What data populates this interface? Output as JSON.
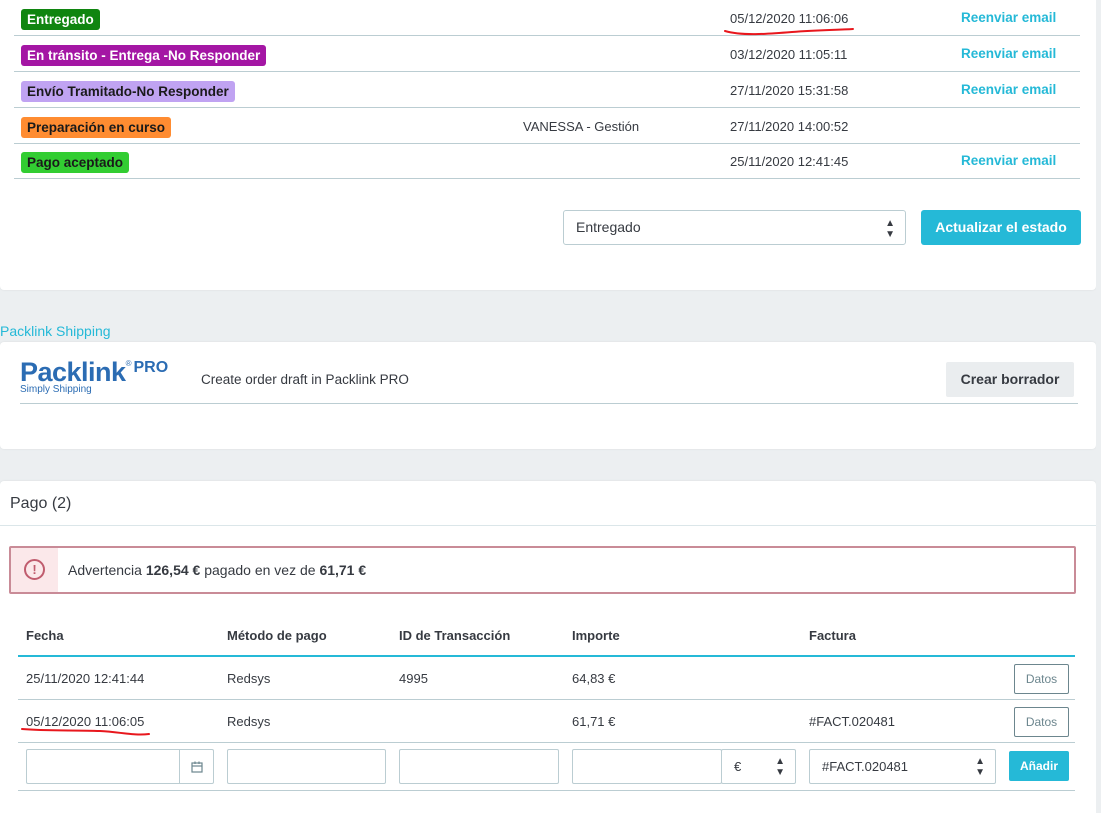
{
  "status_history": {
    "rows": [
      {
        "status": "Entregado",
        "employee": "",
        "date": "05/12/2020 11:06:06",
        "action": "Reenviar email",
        "color": "#108510",
        "text_color": "#ffffff"
      },
      {
        "status": "En tránsito - Entrega -No Responder",
        "employee": "",
        "date": "03/12/2020 11:05:11",
        "action": "Reenviar email",
        "color": "#a416a4",
        "text_color": "#ffffff"
      },
      {
        "status": "Envío Tramitado-No Responder",
        "employee": "",
        "date": "27/11/2020 15:31:58",
        "action": "Reenviar email",
        "color": "#c0a3f2",
        "text_color": "#1a1a1a"
      },
      {
        "status": "Preparación en curso",
        "employee": "VANESSA - Gestión",
        "date": "27/11/2020 14:00:52",
        "action": "",
        "color": "#ff8c31",
        "text_color": "#1a1a1a"
      },
      {
        "status": "Pago aceptado",
        "employee": "",
        "date": "25/11/2020 12:41:45",
        "action": "Reenviar email",
        "color": "#32cd32",
        "text_color": "#1a1a1a"
      }
    ],
    "select_value": "Entregado",
    "update_button": "Actualizar el estado"
  },
  "packlink": {
    "section_title": "Packlink Shipping",
    "logo_word": "Packlink",
    "logo_reg": "®",
    "logo_pro": "PRO",
    "logo_tagline": "Simply Shipping",
    "description": "Create order draft in Packlink PRO",
    "create_button": "Crear borrador"
  },
  "payment": {
    "title": "Pago (2)",
    "warning": {
      "prefix": "Advertencia",
      "paid_amount": "126,54 €",
      "middle": "pagado en vez de",
      "expected_amount": "61,71 €"
    },
    "columns": [
      "Fecha",
      "Método de pago",
      "ID de Transacción",
      "Importe",
      "Factura"
    ],
    "rows": [
      {
        "date": "25/11/2020 12:41:44",
        "method": "Redsys",
        "transaction_id": "4995",
        "amount": "64,83 €",
        "invoice": "",
        "button": "Datos"
      },
      {
        "date": "05/12/2020 11:06:05",
        "method": "Redsys",
        "transaction_id": "",
        "amount": "61,71 €",
        "invoice": "#FACT.020481",
        "button": "Datos"
      }
    ],
    "new_row": {
      "date": "",
      "method": "",
      "transaction_id": "",
      "amount": "",
      "currency": "€",
      "invoice": "#FACT.020481",
      "add_button": "Añadir"
    }
  },
  "colors": {
    "accent": "#25b9d7",
    "annotation_red": "#e8171d",
    "warning_border": "#c98b97"
  }
}
